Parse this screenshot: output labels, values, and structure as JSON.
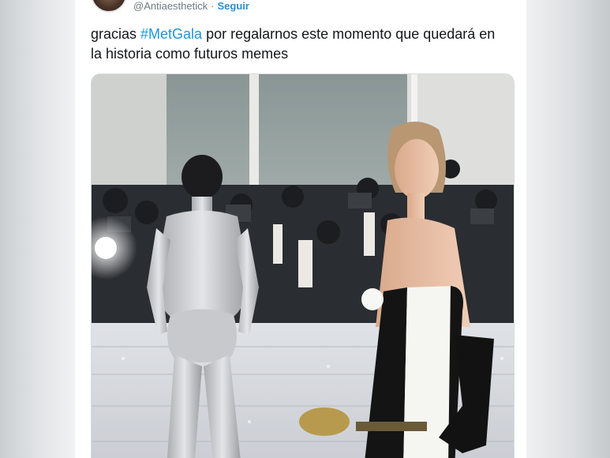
{
  "tweet": {
    "handle": "@Antiaesthetick",
    "separator": "·",
    "follow_label": "Seguir",
    "text_before": "gracias ",
    "hashtag": "#MetGala",
    "text_after": " por regalarnos este momento que quedará en la historia como futuros memes"
  },
  "media": {
    "photo_icon": "photo-image"
  },
  "colors": {
    "hashtag": "#1b95e0",
    "follow": "#2b8fd6",
    "text": "#14171a",
    "handle": "#6f7b85"
  }
}
